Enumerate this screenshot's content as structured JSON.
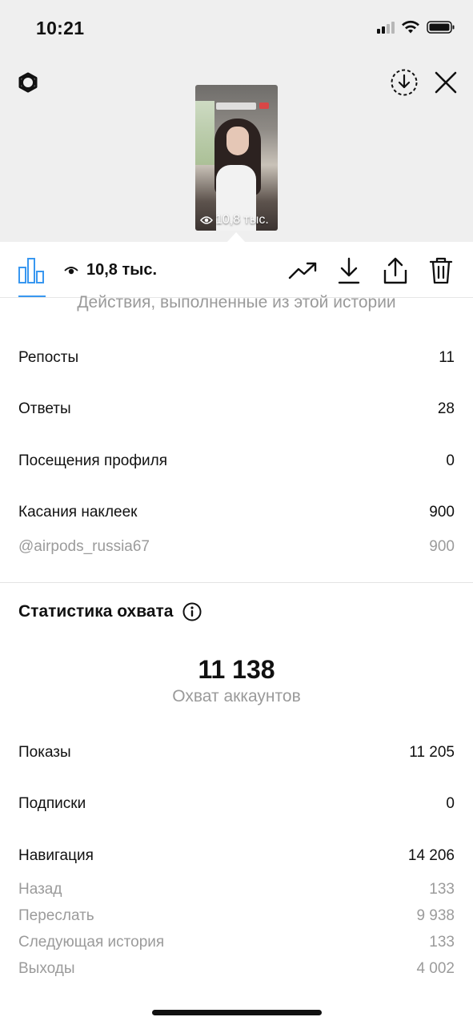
{
  "status_bar": {
    "time": "10:21"
  },
  "story": {
    "thumbnail_views": "10,8 тыс."
  },
  "toolbar": {
    "views": "10,8 тыс."
  },
  "actions_section": {
    "caption": "Действия, выполненные из этой истории",
    "rows": [
      {
        "label": "Репосты",
        "value": "11"
      },
      {
        "label": "Ответы",
        "value": "28"
      },
      {
        "label": "Посещения профиля",
        "value": "0"
      },
      {
        "label": "Касания наклеек",
        "value": "900"
      }
    ],
    "sticker_detail": {
      "label": "@airpods_russia67",
      "value": "900"
    }
  },
  "reach_section": {
    "title": "Статистика охвата",
    "accounts_reached": "11 138",
    "accounts_reached_label": "Охват аккаунтов",
    "rows": [
      {
        "label": "Показы",
        "value": "11 205"
      },
      {
        "label": "Подписки",
        "value": "0"
      },
      {
        "label": "Навигация",
        "value": "14 206"
      }
    ],
    "navigation_details": [
      {
        "label": "Назад",
        "value": "133"
      },
      {
        "label": "Переслать",
        "value": "9 938"
      },
      {
        "label": "Следующая история",
        "value": "133"
      },
      {
        "label": "Выходы",
        "value": "4 002"
      }
    ]
  },
  "icons": {
    "gear": "gear-icon",
    "save": "download-circle-icon",
    "close": "close-icon",
    "chart": "bar-chart-icon",
    "eye": "eye-icon",
    "trend": "trending-icon",
    "download": "download-icon",
    "share": "share-icon",
    "delete": "trash-icon",
    "info": "info-icon"
  },
  "colors": {
    "accent": "#3897f0",
    "header_bg": "#efefef",
    "secondary_text": "#9b9b9b"
  }
}
